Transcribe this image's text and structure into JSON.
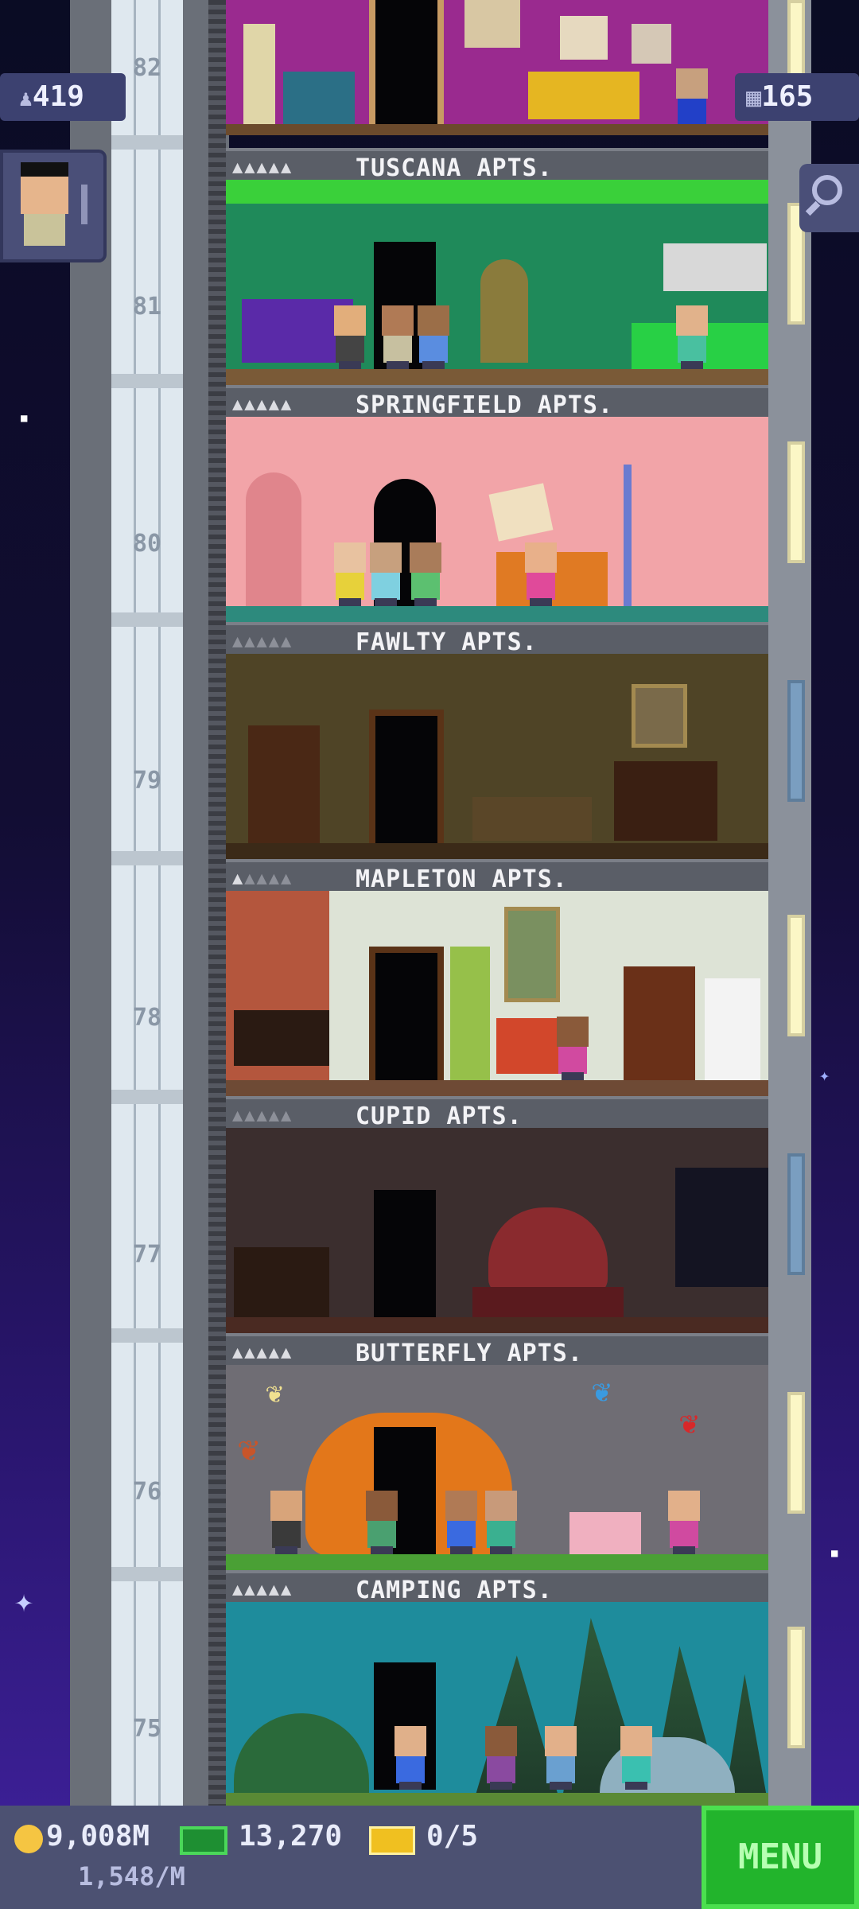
{
  "stats": {
    "population": "419",
    "bux_count": "165"
  },
  "floors": [
    {
      "number": "82",
      "name": "",
      "stocked": 0
    },
    {
      "number": "81",
      "name": "TUSCANA APTS.",
      "stocked": 5
    },
    {
      "number": "80",
      "name": "SPRINGFIELD APTS.",
      "stocked": 5
    },
    {
      "number": "79",
      "name": "FAWLTY APTS.",
      "stocked": 0
    },
    {
      "number": "78",
      "name": "MAPLETON APTS.",
      "stocked": 1
    },
    {
      "number": "77",
      "name": "CUPID APTS.",
      "stocked": 0
    },
    {
      "number": "76",
      "name": "BUTTERFLY APTS.",
      "stocked": 5
    },
    {
      "number": "75",
      "name": "CAMPING APTS.",
      "stocked": 5
    }
  ],
  "labels": {
    "tuscana": "TUSCANA APTS.",
    "springfield": "SPRINGFIELD APTS.",
    "fawlty": "FAWLTY APTS.",
    "mapleton": "MAPLETON APTS.",
    "cupid": "CUPID APTS.",
    "butterfly": "BUTTERFLY APTS.",
    "camping": "CAMPING APTS.",
    "dots_full": "▲▲▲▲▲",
    "dots_one": "▲",
    "dots_rest": "▲▲▲▲"
  },
  "bottom_bar": {
    "coins": "9,008M",
    "coin_rate": "1,548/M",
    "bux": "13,270",
    "tickets": "0/5",
    "menu_label": "MENU"
  },
  "colors": {
    "menu_green": "#22b42c",
    "accent_text": "#e9ecfa"
  }
}
